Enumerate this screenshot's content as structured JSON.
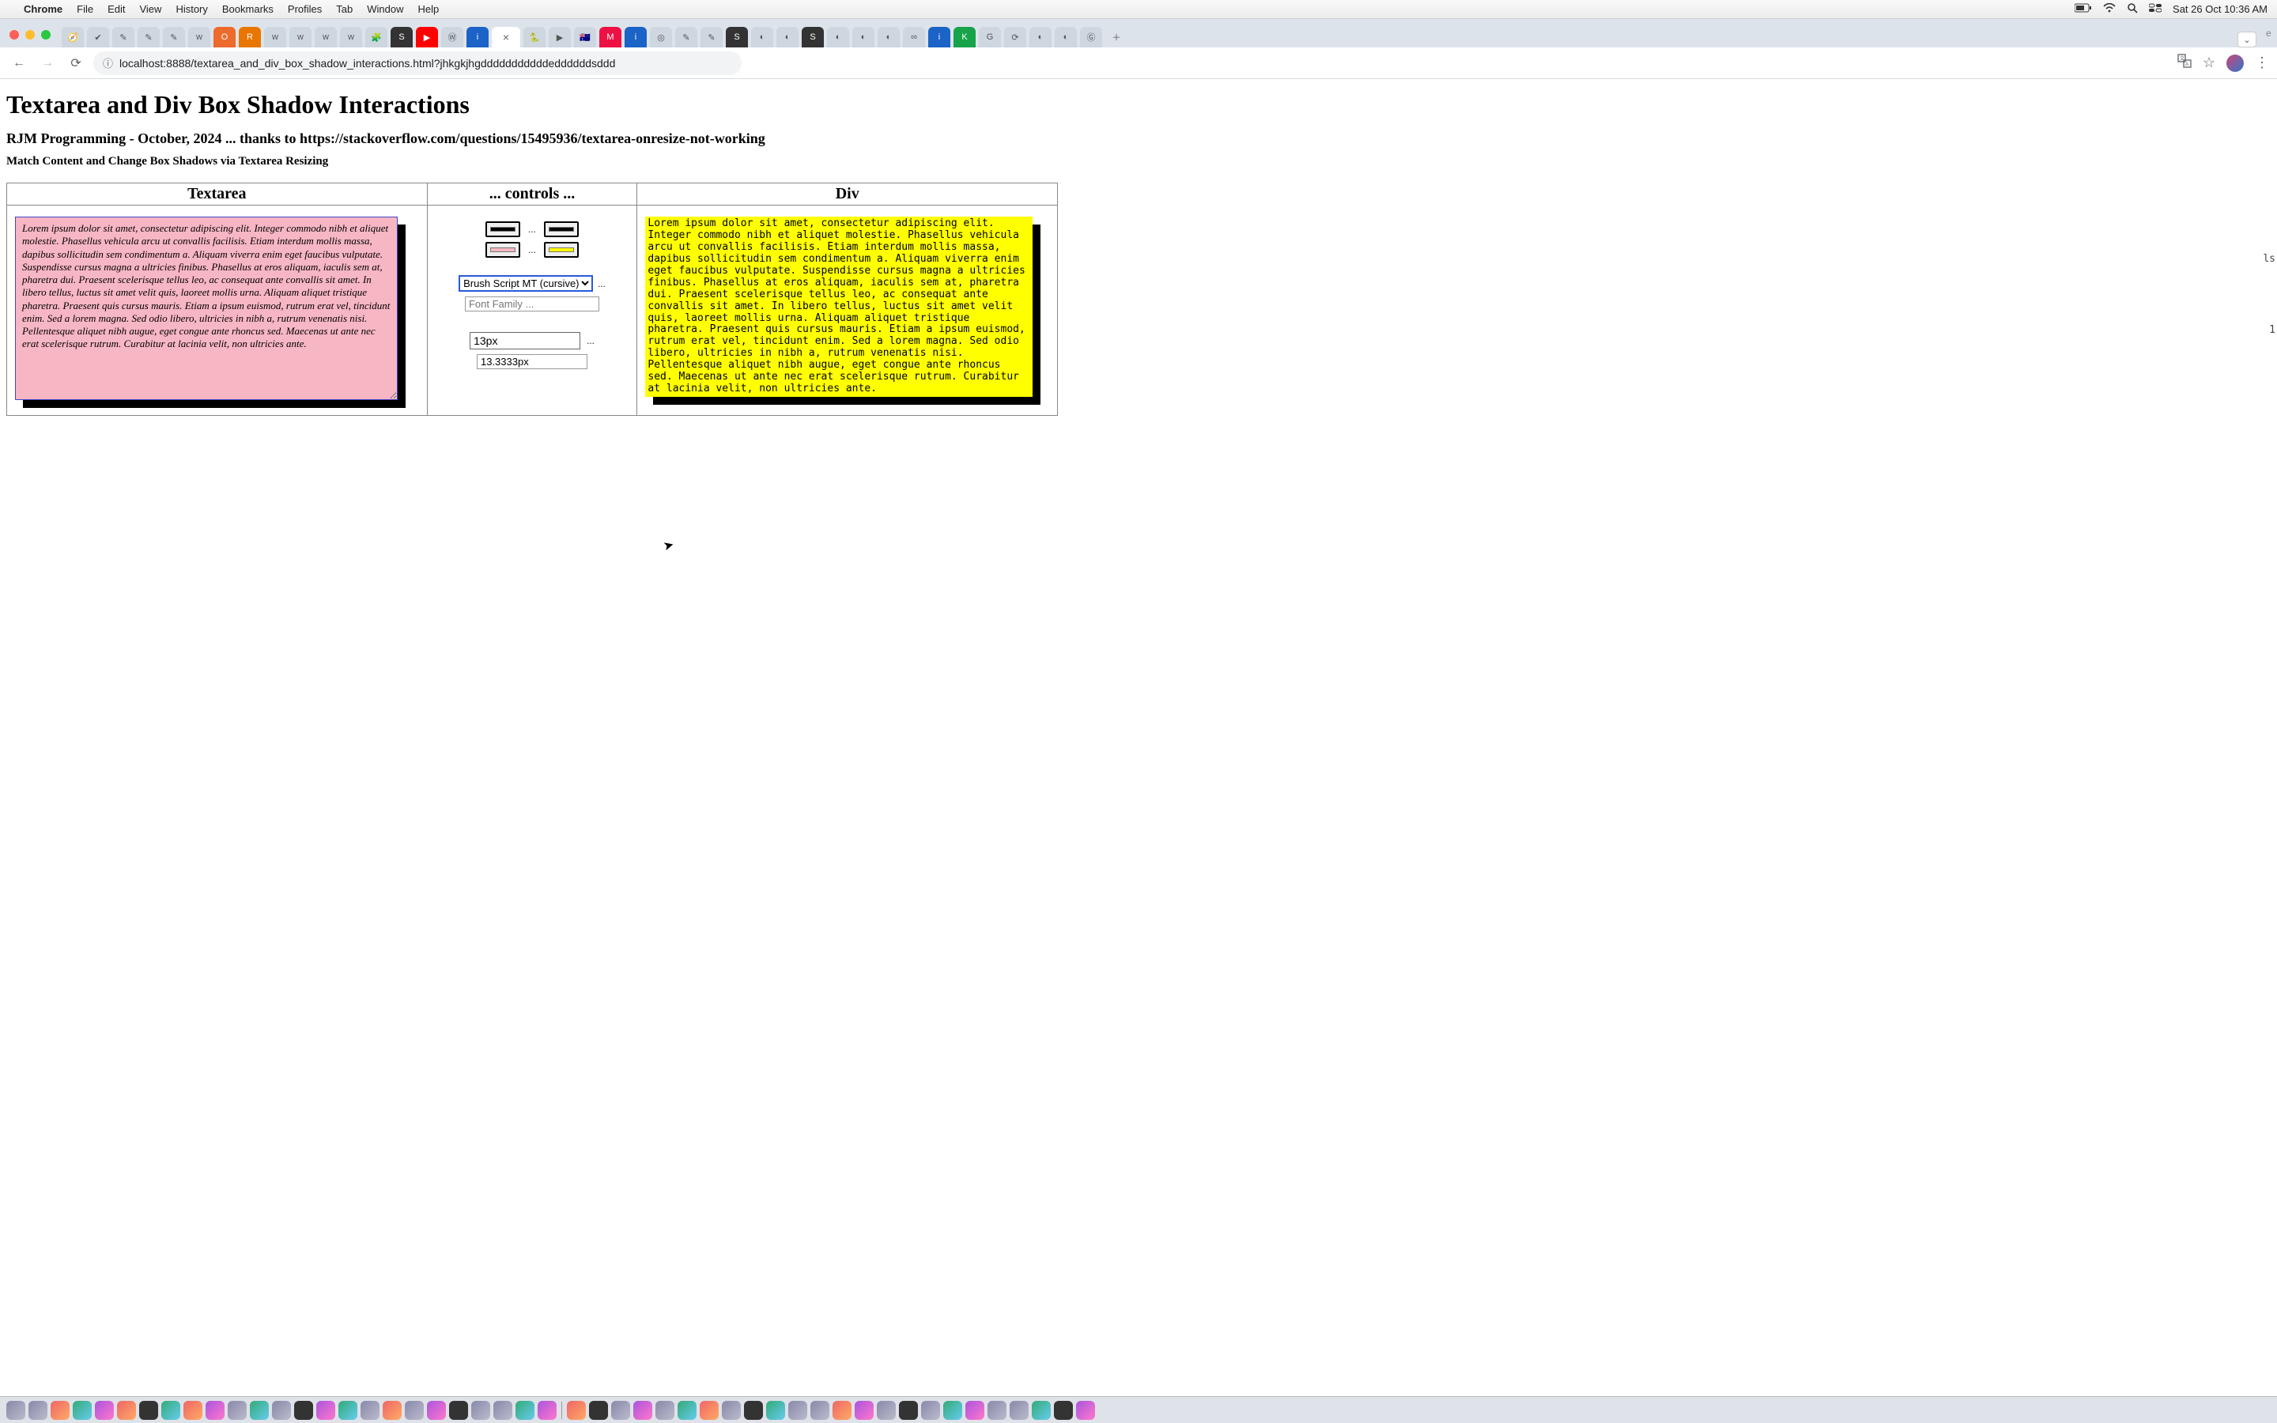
{
  "mac": {
    "menus": [
      "Chrome",
      "File",
      "Edit",
      "View",
      "History",
      "Bookmarks",
      "Profiles",
      "Tab",
      "Window",
      "Help"
    ],
    "clock": "Sat 26 Oct  10:36 AM"
  },
  "browser": {
    "url": "localhost:8888/textarea_and_div_box_shadow_interactions.html?jhkgkjhgdddddddddddeddddddsddd",
    "url_host_prefix": "localhost",
    "tabs_count": 44
  },
  "page": {
    "h1": "Textarea and Div Box Shadow Interactions",
    "sub": "RJM Programming - October, 2024 ... thanks to https://stackoverflow.com/questions/15495936/textarea-onresize-not-working",
    "note": "Match Content and Change Box Shadows via Textarea Resizing",
    "headers": {
      "left": "Textarea",
      "mid": "... controls ...",
      "right": "Div"
    },
    "lorem": "Lorem ipsum dolor sit amet, consectetur adipiscing elit. Integer commodo nibh et aliquet molestie. Phasellus vehicula arcu ut convallis facilisis. Etiam interdum mollis massa, dapibus sollicitudin sem condimentum a. Aliquam viverra enim eget faucibus vulputate. Suspendisse cursus magna a ultricies finibus. Phasellus at eros aliquam, iaculis sem at, pharetra dui. Praesent scelerisque tellus leo, ac consequat ante convallis sit amet. In libero tellus, luctus sit amet velit quis, laoreet mollis urna. Aliquam aliquet tristique pharetra. Praesent quis cursus mauris. Etiam a ipsum euismod, rutrum erat vel, tincidunt enim. Sed a lorem magna. Sed odio libero, ultricies in nibh a, rutrum venenatis nisi. Pellentesque aliquet nibh augue, eget congue ante rhoncus sed. Maecenas ut ante nec erat scelerisque rutrum. Curabitur at lacinia velit, non ultricies ante.",
    "controls": {
      "color_left_shadow": "#000000",
      "color_right_shadow": "#000000",
      "color_left_bg": "#f7b6c3",
      "color_right_bg": "#ffff00",
      "dots": "...",
      "font_select": "Brush Script MT (cursive)",
      "font_input_placeholder": "Font Family ...",
      "size1": "13px",
      "size2": "13.3333px"
    },
    "edge_fragments": {
      "a": "ls",
      "b": "1"
    }
  }
}
